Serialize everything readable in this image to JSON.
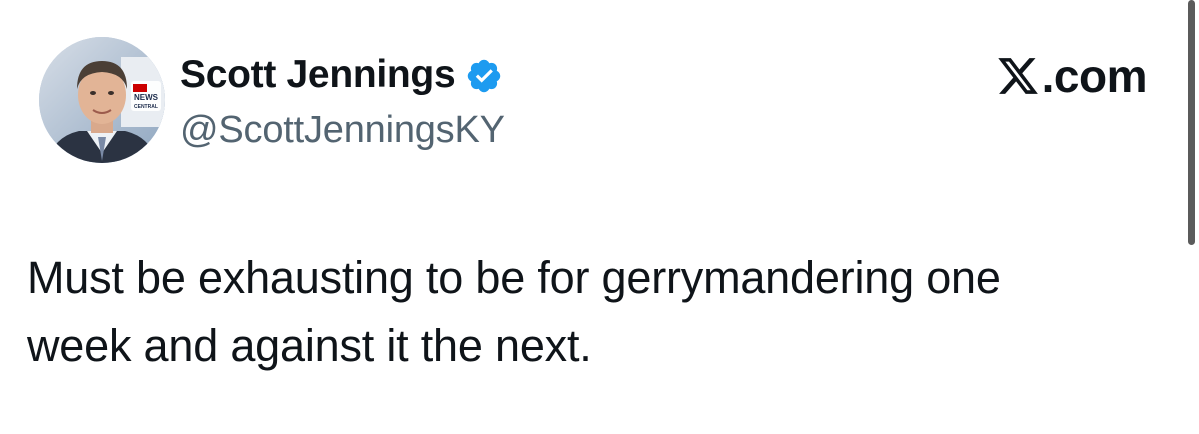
{
  "author": {
    "name": "Scott Jennings",
    "handle": "@ScottJenningsKY",
    "verified": true,
    "avatar_icon": "profile-photo-avatar",
    "avatar_logo_text": "CNN NEWS CENTRAL"
  },
  "brand": {
    "logo_icon": "x-logo-icon",
    "text": ".com"
  },
  "tweet": {
    "lines": [
      "Must be exhausting to be for gerrymandering one",
      "week and against it the next."
    ]
  },
  "colors": {
    "text": "#0f1419",
    "secondary_text": "#536471",
    "verified_blue": "#1d9bf0",
    "background": "#ffffff"
  }
}
